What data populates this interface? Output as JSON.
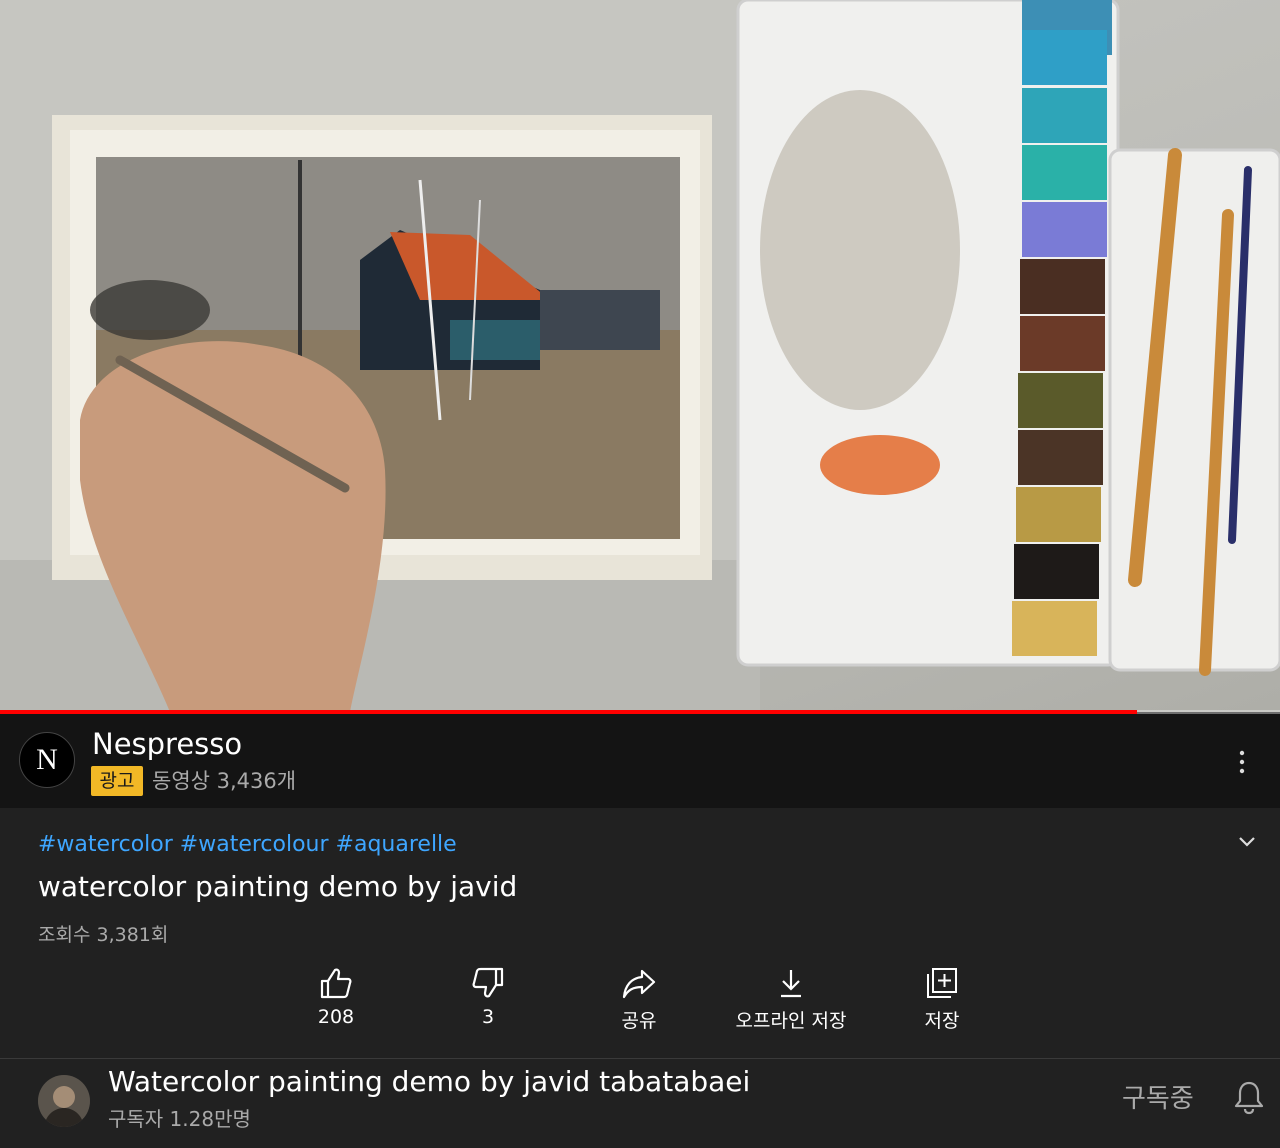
{
  "player": {
    "progress_percent": 88.8,
    "accent_color": "#ff0000"
  },
  "ad": {
    "advertiser": "Nespresso",
    "logo_letter": "N",
    "badge": "광고",
    "video_count": "동영상 3,436개",
    "menu_icon": "more-vert-icon",
    "badge_color": "#f2b826"
  },
  "video": {
    "hashtags": "#watercolor #watercolour #aquarelle",
    "title": "watercolor painting demo by javid",
    "views": "조회수 3,381회",
    "expand_icon": "chevron-down-icon",
    "link_color": "#3ea6ff"
  },
  "actions": [
    {
      "label": "208",
      "icon": "thumbs-up-icon"
    },
    {
      "label": "3",
      "icon": "thumbs-down-icon"
    },
    {
      "label": "공유",
      "icon": "share-icon"
    },
    {
      "label": "오프라인 저장",
      "icon": "download-icon"
    },
    {
      "label": "저장",
      "icon": "add-to-playlist-icon"
    }
  ],
  "channel": {
    "name": "Watercolor painting demo by javid tabatabaei",
    "subscribers": "구독자 1.28만명",
    "subscribe_state": "구독중",
    "bell_icon": "bell-icon"
  }
}
